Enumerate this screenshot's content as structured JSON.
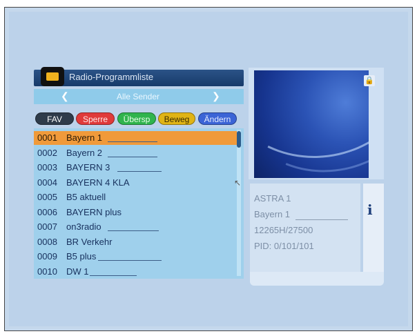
{
  "menu": {
    "title": "Radio-Programmliste",
    "selector": "Alle Sender"
  },
  "buttons": {
    "fav": "FAV",
    "red": "Sperre",
    "green": "Übersp",
    "yellow": "Beweg",
    "blue": "Ändern"
  },
  "channels": [
    {
      "num": "0001",
      "name": "Bayern 1"
    },
    {
      "num": "0002",
      "name": "Bayern 2"
    },
    {
      "num": "0003",
      "name": "BAYERN 3"
    },
    {
      "num": "0004",
      "name": "BAYERN 4 KLA"
    },
    {
      "num": "0005",
      "name": "B5 aktuell"
    },
    {
      "num": "0006",
      "name": "BAYERN plus"
    },
    {
      "num": "0007",
      "name": "on3radio"
    },
    {
      "num": "0008",
      "name": "BR Verkehr"
    },
    {
      "num": "0009",
      "name": "B5 plus"
    },
    {
      "num": "0010",
      "name": "DW 1"
    }
  ],
  "selected_index": 0,
  "info": {
    "satellite": "ASTRA 1",
    "channel": "Bayern 1",
    "transponder": "12265H/27500",
    "pid": "PID: 0/101/101"
  },
  "icons": {
    "radio": "radio-icon",
    "arrow_left": "chevron-left-icon",
    "arrow_right": "chevron-right-icon",
    "info": "info-icon",
    "lock": "lock-icon"
  },
  "colors": {
    "selected_row": "#f09a3a",
    "list_bg": "#9fd0ec",
    "red_button": "#e03a3a",
    "green_button": "#2fb44d",
    "yellow_button": "#e0b415",
    "blue_button": "#3b64d6"
  }
}
